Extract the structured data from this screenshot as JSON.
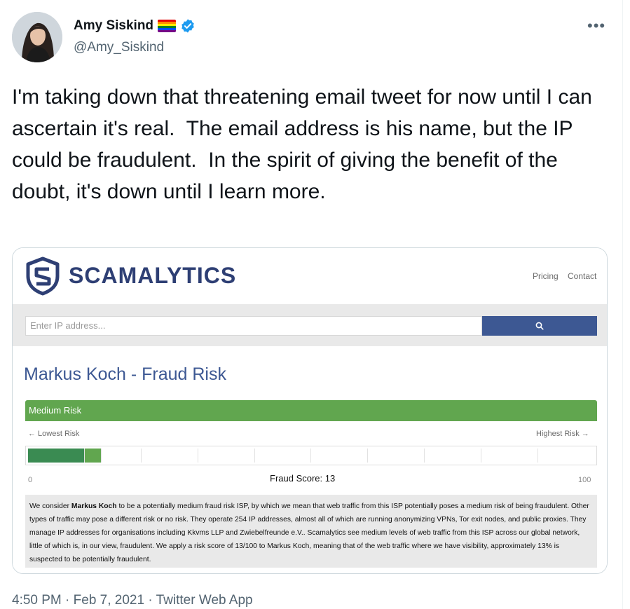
{
  "tweet": {
    "author_name": "Amy Siskind",
    "handle": "@Amy_Siskind",
    "more_label": "•••",
    "text": "I'm taking down that threatening email tweet for now until I can ascertain it's real.  The email address is his name, but the IP could be fraudulent.  In the spirit of giving the benefit of the doubt, it's down until I learn more.",
    "time": "4:50 PM",
    "separator": " · ",
    "date": "Feb 7, 2021",
    "source": "Twitter Web App",
    "icons": {
      "flag": "rainbow-flag-icon",
      "verified": "verified-badge-icon",
      "more": "more-options-icon"
    }
  },
  "screenshot": {
    "brand": "SCAMALYTICS",
    "nav": [
      "Pricing",
      "Contact"
    ],
    "search_placeholder": "Enter IP address...",
    "page_title": "Markus Koch - Fraud Risk",
    "risk_level": "Medium Risk",
    "lowest_label": "← Lowest Risk",
    "highest_label": "Highest Risk →",
    "scale_min": "0",
    "scale_max": "100",
    "fraud_score_label": "Fraud Score: 13",
    "fraud_score": 13,
    "description_before": "We consider ",
    "description_bold": "Markus Koch",
    "description_after": " to be a potentially medium fraud risk ISP, by which we mean that web traffic from this ISP potentially poses a medium risk of being fraudulent. Other types of traffic may pose a different risk or no risk. They operate 254 IP addresses, almost all of which are running anonymizing VPNs, Tor exit nodes, and public proxies. They manage IP addresses for organisations including Kkvms LLP and Zwiebelfreunde e.V.. Scamalytics see medium levels of web traffic from this ISP across our global network, little of which is, in our view, fraudulent. We apply a risk score of 13/100 to Markus Koch, meaning that of the web traffic where we have visibility, approximately 13% is suspected to be potentially fraudulent.",
    "colors": {
      "brand": "#2e3f74",
      "button": "#3d5893",
      "risk_bar": "#61a64f",
      "meter_dark": "#3a8b52",
      "meter_light": "#61a64f"
    }
  }
}
